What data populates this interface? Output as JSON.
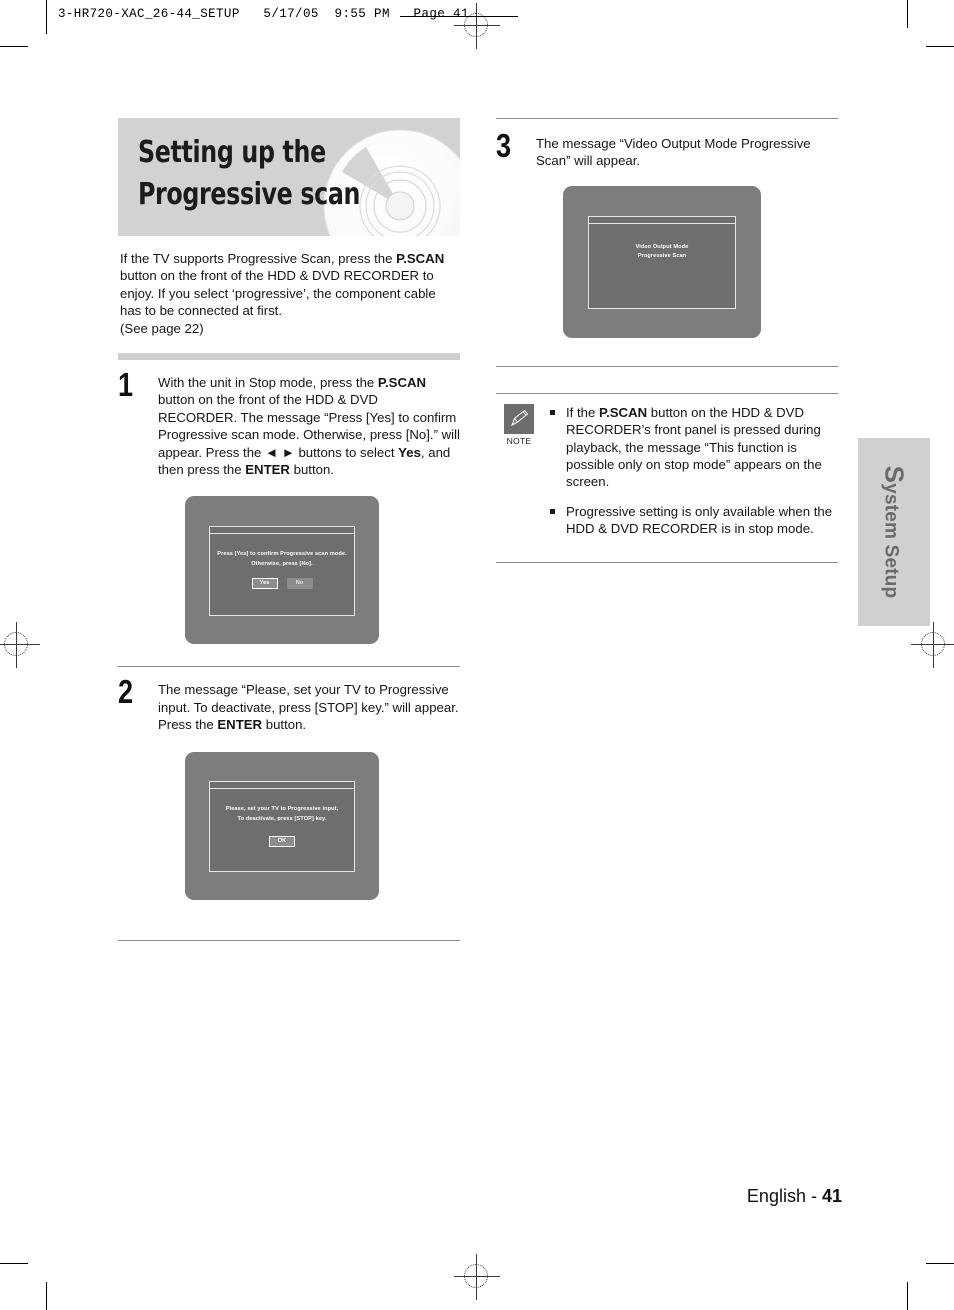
{
  "print_header": {
    "text": "3-HR720-XAC_26-44_SETUP   5/17/05  9:55 PM   Page 41"
  },
  "title": {
    "heading": "Setting up the\nProgressive scan",
    "disc_icon": "dvd-disc-icon"
  },
  "intro": {
    "line1_a": "If the TV supports Progressive Scan, press the ",
    "line1_b": "P.SCAN",
    "line1_c": " button on the front of the HDD & DVD RECORDER to enjoy. If you select ‘progressive’, the component cable has to be connected at first.",
    "line2": "(See page 22)"
  },
  "steps": [
    {
      "number": "1",
      "text_a": "With the unit in Stop mode, press the ",
      "bold_a": "P.SCAN",
      "text_b": " button on the front of the HDD & DVD RECORDER. The message “Press [Yes] to confirm Progressive scan mode. Otherwise, press [No].” will appear. Press the ◄ ► buttons to select ",
      "bold_b": "Yes",
      "text_c": ", and then press the ",
      "bold_c": "ENTER",
      "text_d": " button.",
      "screen": {
        "message": "Press [Yes] to confirm Progressive scan mode.\nOtherwise, press [No].",
        "buttons": [
          {
            "label": "Yes",
            "selected": true
          },
          {
            "label": "No",
            "selected": false
          }
        ]
      }
    },
    {
      "number": "2",
      "text_a": "The message “Please, set your TV to Progressive input. To deactivate, press [STOP] key.” will appear. Press the ",
      "bold_a": "ENTER",
      "text_b": " button.",
      "screen": {
        "message": "Please, set your TV to Progressive input,\nTo deactivate, press [STOP] key.",
        "buttons": [
          {
            "label": "OK",
            "selected": true
          }
        ]
      }
    },
    {
      "number": "3",
      "text_a": "The message “Video Output Mode Progressive Scan” will appear.",
      "screen": {
        "message": "Video Output Mode\nProgressive Scan",
        "buttons": []
      }
    }
  ],
  "note": {
    "icon": "pencil-note-icon",
    "caption": "NOTE",
    "items": [
      {
        "text_a": "If the ",
        "bold_a": "P.SCAN",
        "text_b": " button on the HDD & DVD RECORDER’s front panel is pressed during playback, the message “This function is possible only on stop mode” appears on the screen."
      },
      {
        "text_a": "Progressive setting is only available when the HDD & DVD RECORDER is in stop mode.",
        "bold_a": "",
        "text_b": ""
      }
    ]
  },
  "side_tab": {
    "initial": "S",
    "rest": "ystem Setup"
  },
  "footer": {
    "language": "English",
    "separator": " - ",
    "page_number": "41"
  },
  "colors": {
    "banner_bg": "#d2d2d2",
    "screen_bg": "#7d7d7d",
    "screen_inner_bg": "#6e6e6e",
    "note_badge": "#6d6d6d",
    "side_tab_bg": "#d0d0d0",
    "side_tab_text": "#6a6a6a",
    "separator_bar": "#cfcfcf"
  }
}
